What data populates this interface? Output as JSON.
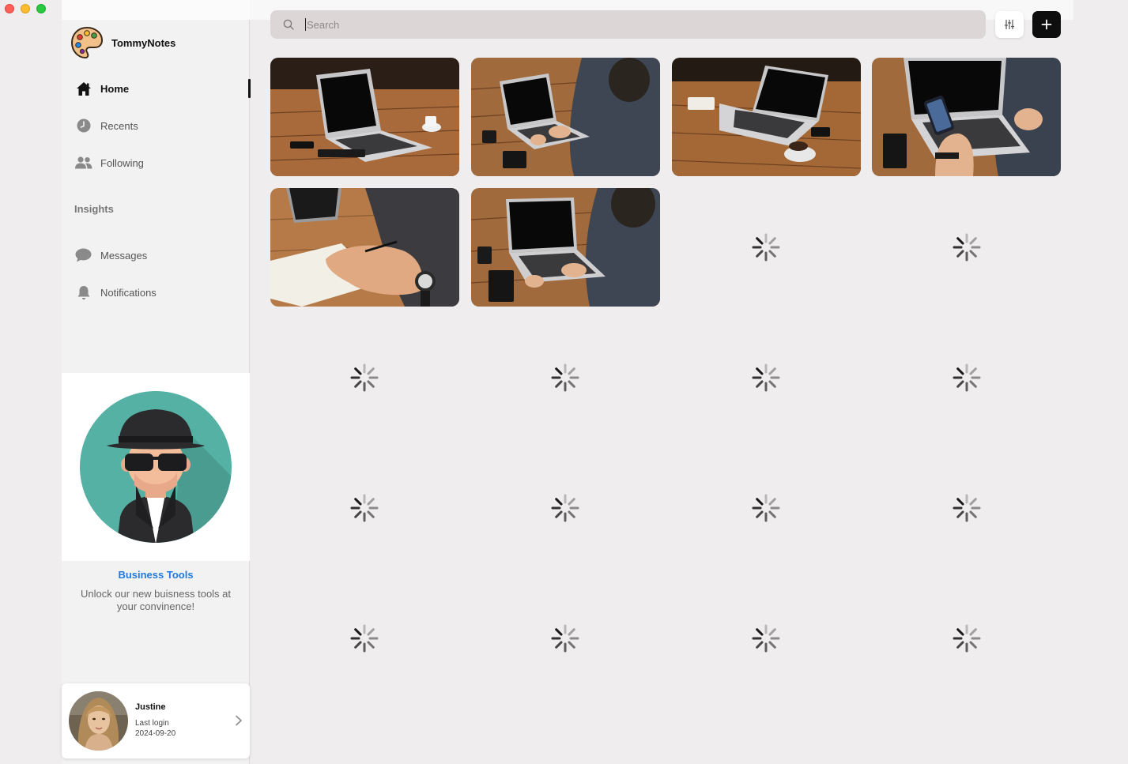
{
  "app": {
    "name": "TommyNotes"
  },
  "nav": {
    "items": [
      {
        "label": "Home",
        "icon": "home-icon",
        "active": true
      },
      {
        "label": "Recents",
        "icon": "clock-icon"
      },
      {
        "label": "Following",
        "icon": "people-icon"
      }
    ],
    "section_label": "Insights",
    "insight_items": [
      {
        "label": "Messages",
        "icon": "chat-bubble-icon"
      },
      {
        "label": "Notifications",
        "icon": "bell-icon"
      }
    ]
  },
  "promo": {
    "title": "Business Tools",
    "text": "Unlock our new buisness tools at your convinence!"
  },
  "user": {
    "name": "Justine",
    "last_login_label": "Last login",
    "last_login_date": "2024-09-20"
  },
  "search": {
    "placeholder": "Search",
    "value": ""
  },
  "gallery": {
    "loaded_images": 6,
    "loading_placeholders": 14
  },
  "colors": {
    "accent": "#1f7be0",
    "search_bg": "#dcd6d6",
    "active": "#111111"
  }
}
